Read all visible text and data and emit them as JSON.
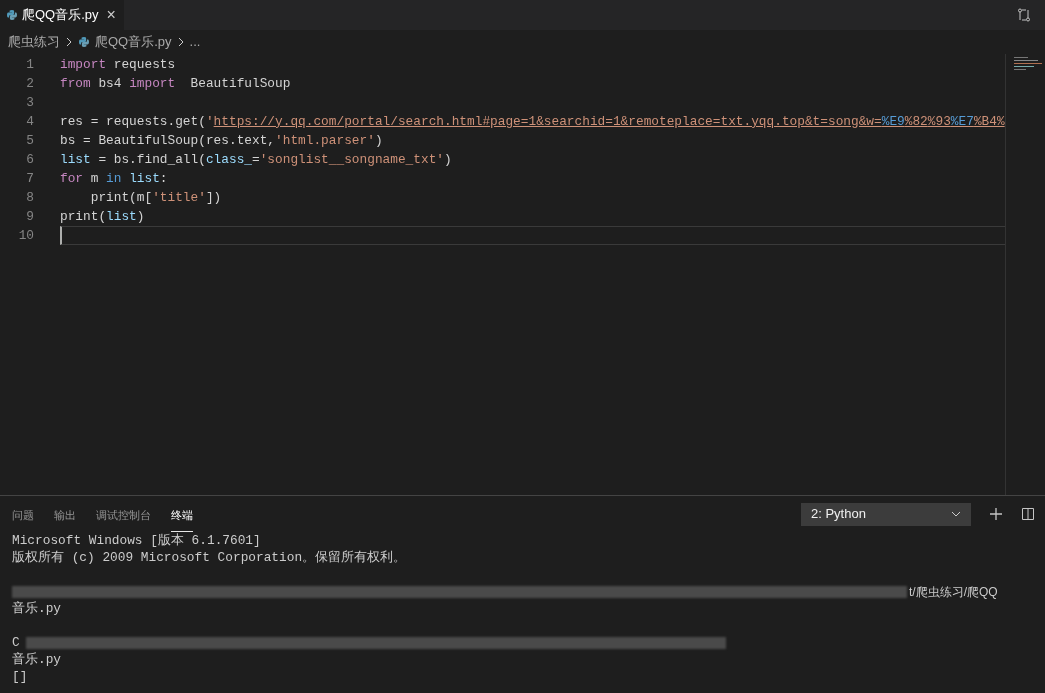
{
  "tab": {
    "title": "爬QQ音乐.py",
    "close": "×",
    "selected": true
  },
  "breadcrumb": {
    "folder": "爬虫练习",
    "file": "爬QQ音乐.py",
    "more": "..."
  },
  "code_lines": [
    {
      "number": "1",
      "current": false,
      "tokens": [
        {
          "kind": "keyword",
          "text": "import"
        },
        {
          "kind": "plain",
          "text": " requests"
        }
      ]
    },
    {
      "number": "2",
      "current": false,
      "tokens": [
        {
          "kind": "keyword",
          "text": "from"
        },
        {
          "kind": "plain",
          "text": " bs4 "
        },
        {
          "kind": "keyword",
          "text": "import"
        },
        {
          "kind": "plain",
          "text": "  BeautifulSoup"
        }
      ]
    },
    {
      "number": "3",
      "current": false
    },
    {
      "number": "4",
      "current": false,
      "tokens": [
        {
          "kind": "plain",
          "text": "res = requests.get("
        },
        {
          "kind": "string",
          "text": "'"
        },
        {
          "kind": "link",
          "text": "https://y.qq.com/portal/search.html#page=1&searchid=1&remoteplace=txt.yqq.top&t=song&w="
        },
        {
          "kind": "escape",
          "text": "%E9"
        },
        {
          "kind": "link",
          "text": "%82"
        },
        {
          "kind": "link",
          "text": "%93"
        },
        {
          "kind": "escape",
          "text": "%E7"
        },
        {
          "kind": "link",
          "text": "%B4%"
        }
      ]
    },
    {
      "number": "5",
      "current": false,
      "tokens": [
        {
          "kind": "plain",
          "text": "bs = BeautifulSoup(res.text,"
        },
        {
          "kind": "string",
          "text": "'html.parser'"
        },
        {
          "kind": "plain",
          "text": ")"
        }
      ]
    },
    {
      "number": "6",
      "current": false,
      "tokens": [
        {
          "kind": "variable",
          "text": "list"
        },
        {
          "kind": "plain",
          "text": " = bs.find_all("
        },
        {
          "kind": "variable",
          "text": "class_"
        },
        {
          "kind": "plain",
          "text": "="
        },
        {
          "kind": "string",
          "text": "'songlist__songname_txt'"
        },
        {
          "kind": "plain",
          "text": ")"
        }
      ]
    },
    {
      "number": "7",
      "current": false,
      "tokens": [
        {
          "kind": "keyword",
          "text": "for"
        },
        {
          "kind": "plain",
          "text": " m "
        },
        {
          "kind": "operator",
          "text": "in"
        },
        {
          "kind": "variable",
          "text": " list"
        },
        {
          "kind": "plain",
          "text": ":"
        }
      ]
    },
    {
      "number": "8",
      "current": false,
      "tokens": [
        {
          "kind": "plain",
          "text": "    print(m["
        },
        {
          "kind": "string",
          "text": "'title'"
        },
        {
          "kind": "plain",
          "text": "])"
        }
      ]
    },
    {
      "number": "9",
      "current": false,
      "tokens": [
        {
          "kind": "plain",
          "text": "print("
        },
        {
          "kind": "variable",
          "text": "list"
        },
        {
          "kind": "plain",
          "text": ")"
        }
      ]
    },
    {
      "number": "10",
      "current": true
    }
  ],
  "panel": {
    "tabs": [
      {
        "label": "问题",
        "selected": false
      },
      {
        "label": "输出",
        "selected": false
      },
      {
        "label": "调试控制台",
        "selected": false
      },
      {
        "label": "终端",
        "selected": true
      }
    ],
    "terminal_select": "2: Python",
    "terminal_lines": [
      {
        "kind": "text",
        "text": "Microsoft Windows [版本 6.1.7601]"
      },
      {
        "kind": "text",
        "text": "版权所有 (c) 2009 Microsoft Corporation。保留所有权利。"
      },
      {
        "kind": "blank"
      },
      {
        "kind": "redacted",
        "text": "t/爬虫练习/爬QQ"
      },
      {
        "kind": "text",
        "text": "音乐.py"
      },
      {
        "kind": "blank"
      },
      {
        "kind": "redacted_start",
        "text": "C"
      },
      {
        "kind": "text",
        "text": "音乐.py"
      },
      {
        "kind": "text",
        "text": "[]"
      }
    ]
  }
}
